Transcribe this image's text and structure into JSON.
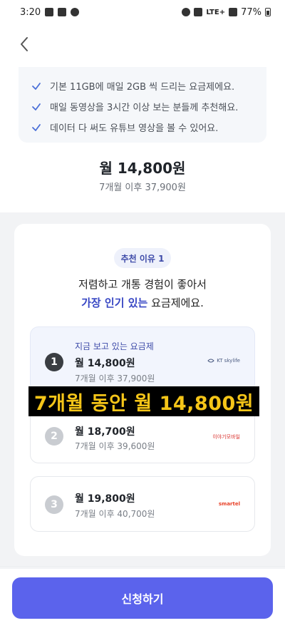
{
  "status_bar": {
    "time": "3:20",
    "network": "LTE+",
    "battery": "77%"
  },
  "features": [
    "기본 11GB에 매일 2GB 씩 드리는 요금제에요.",
    "매일 동영상을 3시간 이상 보는 분들께 추천해요.",
    "데이터 다 써도 유튜브 영상을 볼 수 있어요."
  ],
  "price": {
    "main": "월 14,800원",
    "sub": "7개월 이후 37,900원"
  },
  "reason": {
    "pill": "추천 이유 1",
    "line1": "저렴하고 개통 경험이 좋아서",
    "line2_highlight": "가장 인기 있는",
    "line2_rest": " 요금제에요."
  },
  "plans": [
    {
      "rank": "1",
      "current_label": "지금 보고 있는 요금제",
      "price": "월 14,800원",
      "after": "7개월 이후 37,900원",
      "logo": "KT skylife",
      "logo_color": "#4a5a80",
      "badge_color": "#3a3d42"
    },
    {
      "rank": "2",
      "price": "월 18,700원",
      "after": "7개월 이후 39,600원",
      "logo": "이야기모바일",
      "logo_color": "#d9302c",
      "badge_color": "#c9ccd1"
    },
    {
      "rank": "3",
      "price": "월 19,800원",
      "after": "7개월 이후 40,700원",
      "logo": "smartel",
      "logo_color": "#e8432a",
      "badge_color": "#c9ccd1"
    }
  ],
  "promo_banner": "7개월 동안 월 14,800원",
  "apply_button": "신청하기",
  "colors": {
    "accent": "#5b63ec",
    "highlight": "#3847c4",
    "banner_text": "#f5c518"
  }
}
